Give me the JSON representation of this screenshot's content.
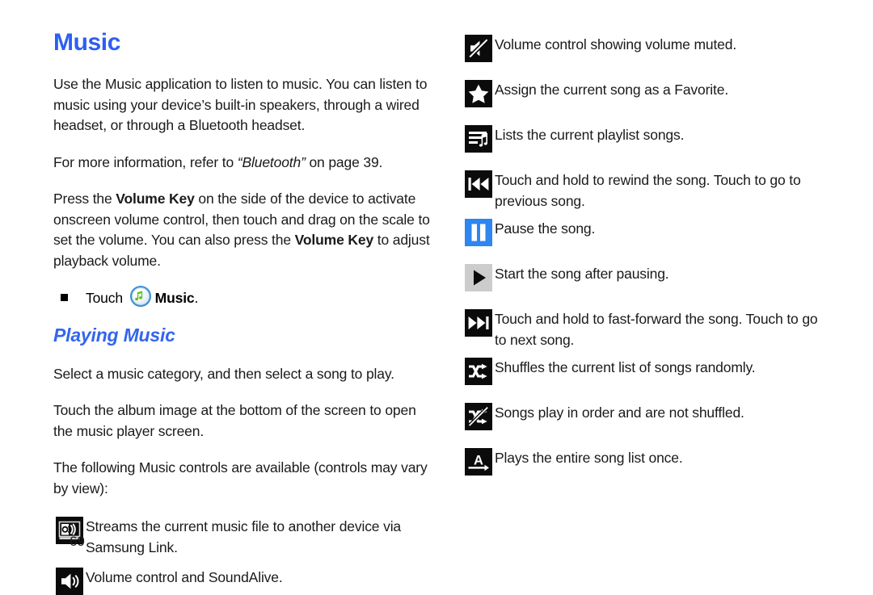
{
  "document": {
    "page_number": "69",
    "accent_heading_color": "#2d5ff0",
    "accent_section_color": "#3366ee",
    "pause_icon_color": "#2e86f0",
    "play_icon_bg_color": "#cccccc"
  },
  "left_column": {
    "chapter_title": "Music",
    "paragraph_1": "Use the Music application to listen to music. You can listen to music using your device’s built-in speakers, through a wired headset, or through a Bluetooth headset.",
    "paragraph_2": {
      "lead": "For more information, refer to ",
      "cross_reference": "“Bluetooth”",
      "trail": " on page 39."
    },
    "paragraph_3": {
      "part_1": "Press the ",
      "bold_1": "Volume Key",
      "part_2": " on the side of the device to activate onscreen volume control, then touch and drag on the scale to set the volume. You can also press the ",
      "bold_2": "Volume Key",
      "part_3": " to adjust playback volume."
    },
    "step": {
      "verb": "Touch ",
      "icon_name": "music-app-icon",
      "app_label": "Music",
      "period": "."
    },
    "section_title": "Playing Music",
    "paragraph_4": "Select a music category, and then select a song to play.",
    "paragraph_5": "Touch the album image at the bottom of the screen to open the music player screen.",
    "paragraph_6": "The following Music controls are available (controls may vary by view):",
    "controls": [
      {
        "icon": "samsung-link-stream-icon",
        "description": "Streams the current music file to another device via Samsung Link."
      },
      {
        "icon": "volume-soundalive-icon",
        "description": "Volume control and SoundAlive."
      }
    ]
  },
  "right_column": {
    "controls": [
      {
        "icon": "volume-muted-icon",
        "description": "Volume control showing volume muted."
      },
      {
        "icon": "favorite-star-icon",
        "description": "Assign the current song as a Favorite."
      },
      {
        "icon": "playlist-icon",
        "description": "Lists the current playlist songs."
      },
      {
        "icon": "rewind-previous-icon",
        "description": "Touch and hold to rewind the song. Touch to go to previous song."
      },
      {
        "icon": "pause-icon",
        "description": "Pause the song."
      },
      {
        "icon": "play-icon",
        "description": "Start the song after pausing."
      },
      {
        "icon": "fast-forward-next-icon",
        "description": "Touch and hold to fast-forward the song. Touch to go to next song."
      },
      {
        "icon": "shuffle-on-icon",
        "description": "Shuffles the current list of songs randomly."
      },
      {
        "icon": "shuffle-off-icon",
        "description": "Songs play in order and are not shuffled."
      },
      {
        "icon": "play-all-once-icon",
        "description": "Plays the entire song list once."
      }
    ]
  }
}
